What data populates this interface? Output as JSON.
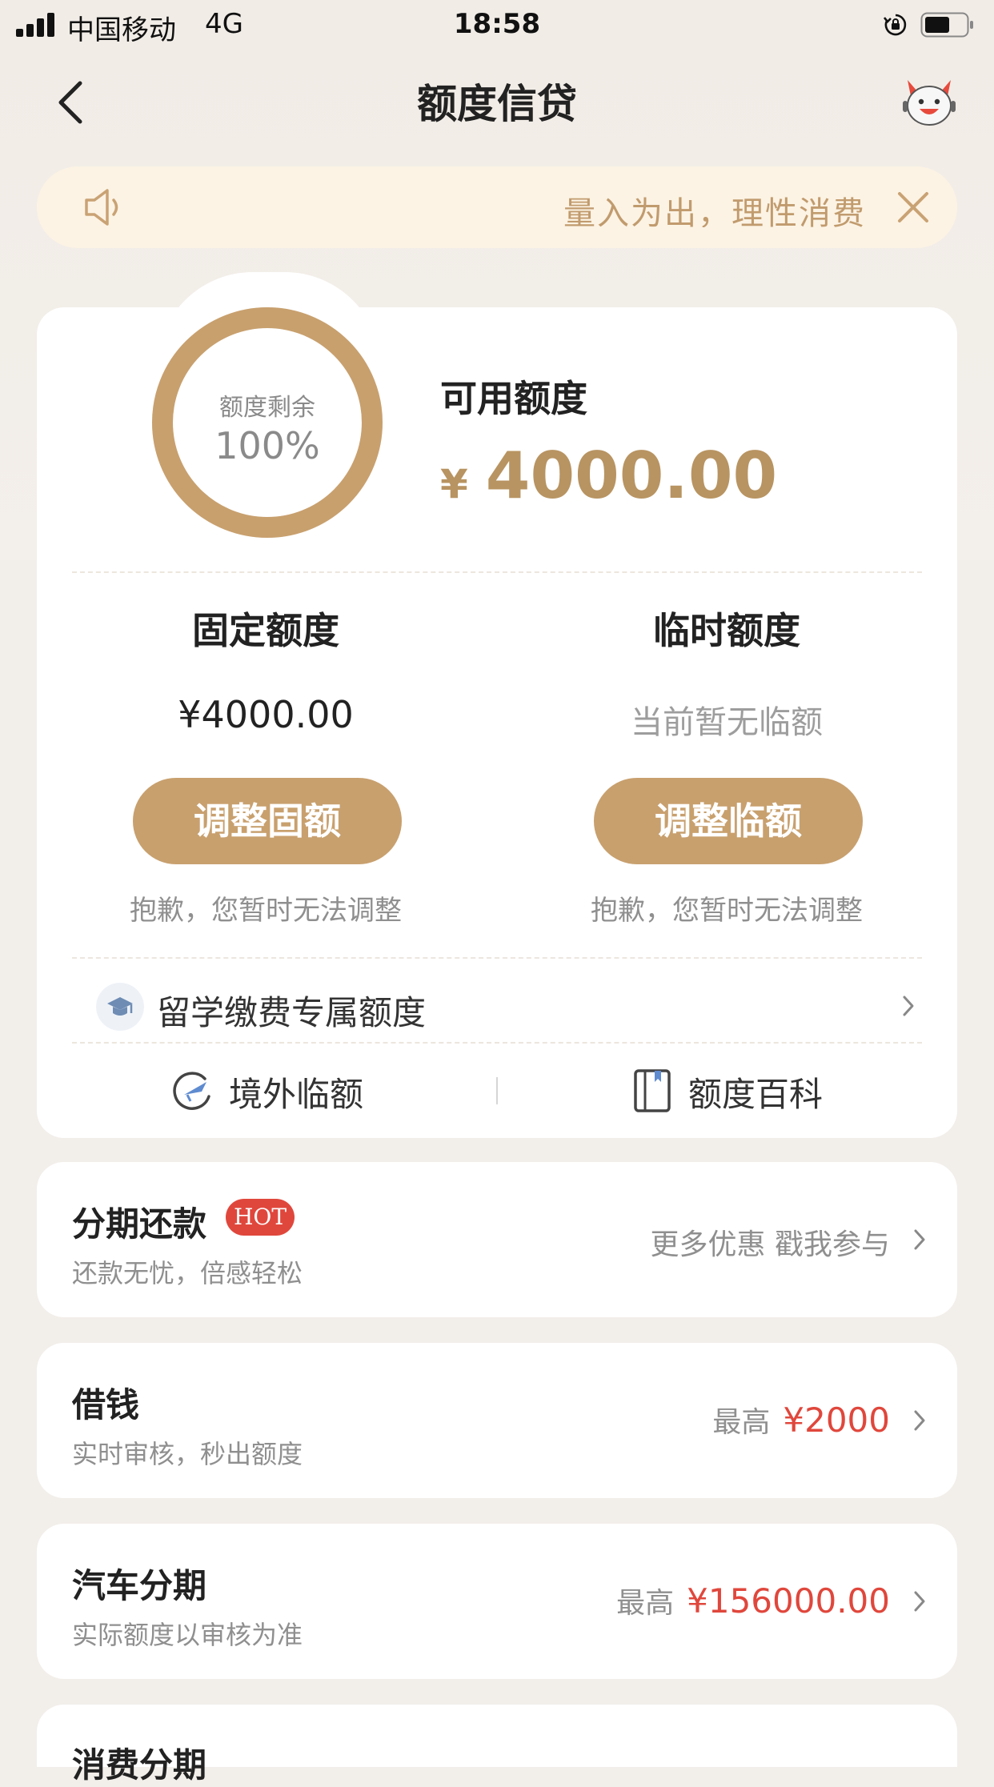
{
  "status_bar": {
    "carrier": "中国移动",
    "network": "4G",
    "time": "18:58"
  },
  "nav": {
    "title": "额度信贷"
  },
  "notice": {
    "text": "量入为出，理性消费"
  },
  "credit": {
    "ring_label": "额度剩余",
    "ring_percent": "100%",
    "remaining_fraction": 1.0,
    "available_label": "可用额度",
    "currency_symbol": "¥",
    "available_amount": "4000.00"
  },
  "fixed": {
    "title": "固定额度",
    "value": "¥4000.00",
    "button": "调整固额",
    "note": "抱歉，您暂时无法调整"
  },
  "temp": {
    "title": "临时额度",
    "value": "当前暂无临额",
    "button": "调整临额",
    "note": "抱歉，您暂时无法调整"
  },
  "study": {
    "label": "留学缴费专属额度"
  },
  "links": {
    "overseas": "境外临额",
    "wiki": "额度百科"
  },
  "cards": [
    {
      "title": "分期还款",
      "badge": "HOT",
      "subtitle": "还款无忧，倍感轻松",
      "right_text": "更多优惠 戳我参与"
    },
    {
      "title": "借钱",
      "subtitle": "实时审核，秒出额度",
      "right_prefix": "最高",
      "right_value": "¥2000"
    },
    {
      "title": "汽车分期",
      "subtitle": "实际额度以审核为准",
      "right_prefix": "最高",
      "right_value": "¥156000.00"
    },
    {
      "title": "消费分期"
    }
  ],
  "colors": {
    "accent_gold": "#c8a06e",
    "amount_gold": "#b89462",
    "hot_red": "#e0473c",
    "notice_bg": "#fcf3e4",
    "page_bg": "#f2eeea"
  }
}
